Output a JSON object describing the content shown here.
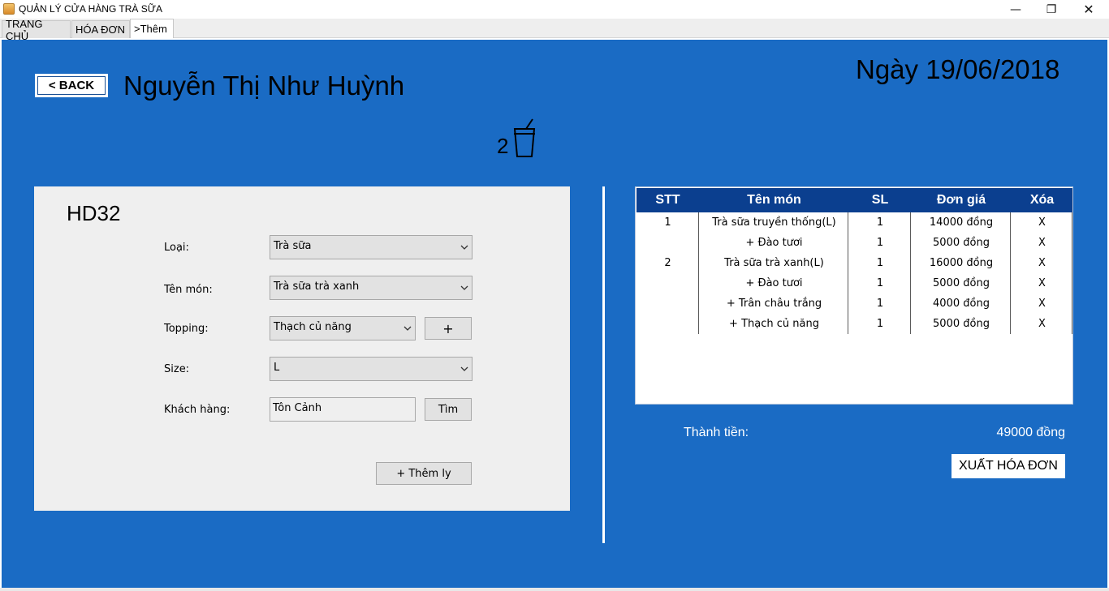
{
  "window": {
    "title": "QUẢN LÝ CỬA HÀNG TRÀ SỮA",
    "minimize_glyph": "—",
    "maximize_glyph": "❐",
    "close_glyph": "✕"
  },
  "tabs": [
    {
      "label": "TRANG CHỦ"
    },
    {
      "label": "HÓA ĐƠN"
    },
    {
      "label": ">Thêm",
      "selected": true
    }
  ],
  "header": {
    "back_label": "< BACK",
    "staff_name": "Nguyễn Thị Như Huỳnh",
    "date": "Ngày 19/06/2018",
    "cup_count": "2",
    "cup_icon": "cup-icon"
  },
  "form": {
    "invoice_code": "HD32",
    "type_label": "Loại:",
    "type_value": "Trà sữa",
    "item_label": "Tên món:",
    "item_value": "Trà sữa trà xanh",
    "topping_label": "Topping:",
    "topping_value": "Thạch củ năng",
    "add_topping_label": "+",
    "size_label": "Size:",
    "size_value": "L",
    "customer_label": "Khách hàng:",
    "customer_value": "Tôn Cảnh",
    "search_label": "Tìm",
    "add_cup_label": "+ Thêm ly"
  },
  "order_table": {
    "headers": [
      "STT",
      "Tên món",
      "SL",
      "Đơn giá",
      "Xóa"
    ],
    "rows": [
      {
        "stt": "1",
        "name": "Trà sữa truyền thống(L)",
        "sl": "1",
        "price": "14000 đồng",
        "del": "X"
      },
      {
        "stt": "",
        "name": "+ Đào tươi",
        "sl": "1",
        "price": "5000 đồng",
        "del": "X"
      },
      {
        "stt": "2",
        "name": "Trà sữa trà xanh(L)",
        "sl": "1",
        "price": "16000 đồng",
        "del": "X"
      },
      {
        "stt": "",
        "name": "+ Đào tươi",
        "sl": "1",
        "price": "5000 đồng",
        "del": "X"
      },
      {
        "stt": "",
        "name": "+ Trân châu trắng",
        "sl": "1",
        "price": "4000 đồng",
        "del": "X"
      },
      {
        "stt": "",
        "name": "+ Thạch củ năng",
        "sl": "1",
        "price": "5000 đồng",
        "del": "X"
      }
    ]
  },
  "summary": {
    "total_label": "Thành tiền:",
    "total_value": "49000 đồng",
    "export_label": "XUẤT  HÓA ĐƠN"
  },
  "colors": {
    "main_background": "#1a6bc4",
    "table_header": "#0b3f8f",
    "form_panel": "#efefef"
  }
}
